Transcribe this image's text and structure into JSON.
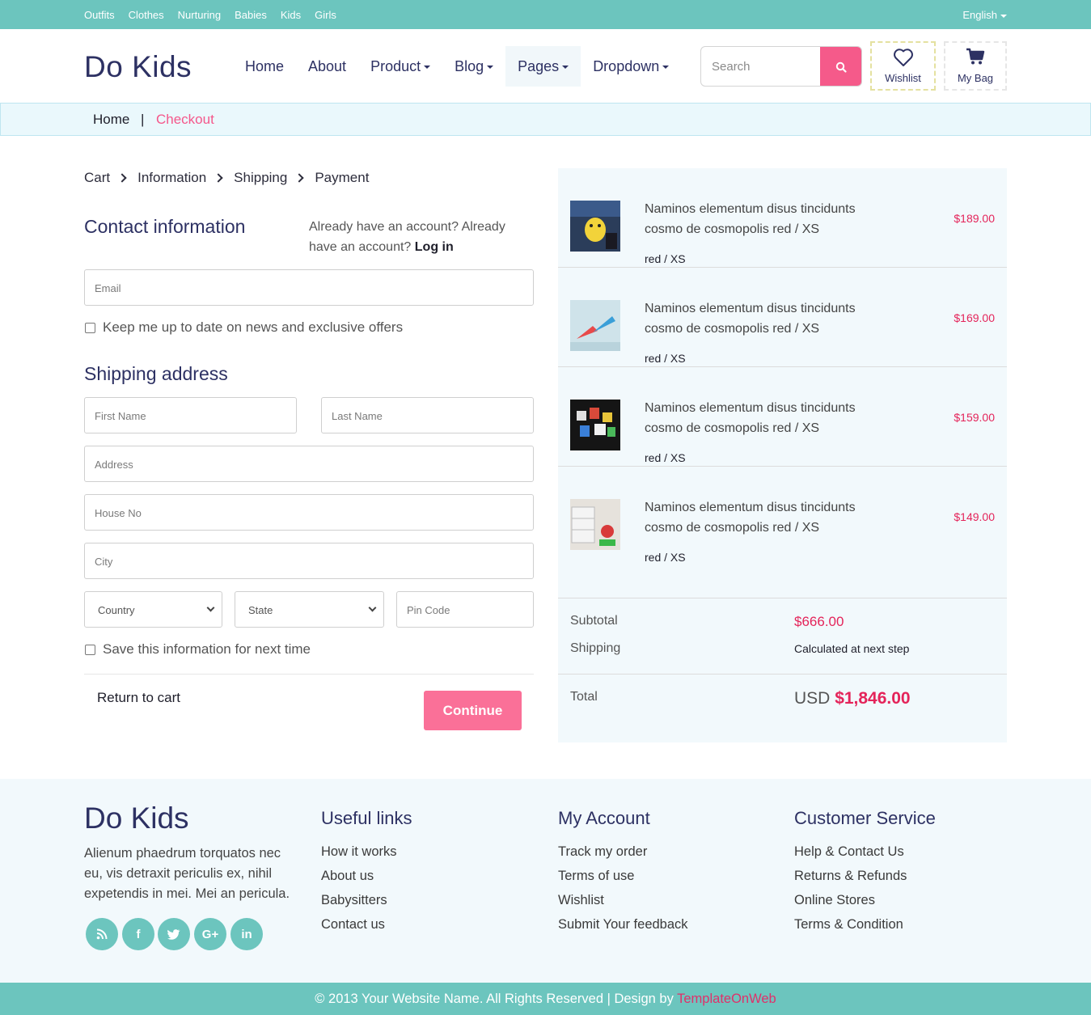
{
  "topbar": {
    "links": [
      "Outfits",
      "Clothes",
      "Nurturing",
      "Babies",
      "Kids",
      "Girls"
    ],
    "language": "English"
  },
  "header": {
    "logo": "Do Kids",
    "nav": [
      "Home",
      "About",
      "Product",
      "Blog",
      "Pages",
      "Dropdown"
    ],
    "search_placeholder": "Search",
    "wishlist_label": "Wishlist",
    "bag_label": "My Bag"
  },
  "breadcrumb": {
    "home": "Home",
    "separator": "|",
    "current": "Checkout"
  },
  "steps": [
    "Cart",
    "Information",
    "Shipping",
    "Payment"
  ],
  "contact": {
    "title": "Contact information",
    "already_text": "Already have an account? Already have an account?",
    "login_link": "Log in",
    "email_placeholder": "Email",
    "newsletter_label": "Keep me up to date on news and exclusive offers"
  },
  "shipping": {
    "title": "Shipping address",
    "first_name": "First Name",
    "last_name": "Last Name",
    "address": "Address",
    "house_no": "House No",
    "city": "City",
    "country": "Country",
    "state": "State",
    "pin_code": "Pin Code",
    "save_label": "Save this information for next time",
    "return_label": "Return to cart",
    "continue_label": "Continue"
  },
  "order": {
    "items": [
      {
        "name": "Naminos elementum disus tincidunts cosmo de cosmopolis red / XS",
        "variant": "red / XS",
        "price": "$189.00"
      },
      {
        "name": "Naminos elementum disus tincidunts cosmo de cosmopolis red / XS",
        "variant": "red / XS",
        "price": "$169.00"
      },
      {
        "name": "Naminos elementum disus tincidunts cosmo de cosmopolis red / XS",
        "variant": "red / XS",
        "price": "$159.00"
      },
      {
        "name": "Naminos elementum disus tincidunts cosmo de cosmopolis red / XS",
        "variant": "red / XS",
        "price": "$149.00"
      }
    ],
    "subtotal_label": "Subtotal",
    "subtotal_value": "$666.00",
    "shipping_label": "Shipping",
    "shipping_value": "Calculated at next step",
    "total_label": "Total",
    "total_currency": "USD",
    "total_value": "$1,846.00"
  },
  "footer": {
    "logo": "Do Kids",
    "about": "Alienum phaedrum torquatos nec eu, vis detraxit periculis ex, nihil expetendis in mei. Mei an pericula.",
    "social_icons": [
      "rss-icon",
      "facebook-icon",
      "twitter-icon",
      "google-plus-icon",
      "linkedin-icon"
    ],
    "columns": [
      {
        "title": "Useful links",
        "links": [
          "How it works",
          "About us",
          "Babysitters",
          "Contact us"
        ]
      },
      {
        "title": "My Account",
        "links": [
          "Track my order",
          "Terms of use",
          "Wishlist",
          "Submit Your feedback"
        ]
      },
      {
        "title": "Customer Service",
        "links": [
          "Help & Contact Us",
          "Returns & Refunds",
          "Online Stores",
          "Terms & Condition"
        ]
      }
    ],
    "copyright": "© 2013 Your Website Name. All Rights Reserved | Design by",
    "brand": "TemplateOnWeb"
  },
  "colors": {
    "teal": "#6cc5be",
    "pink": "#f55a8a",
    "navy": "#2d3163",
    "price_red": "#e4245a"
  }
}
